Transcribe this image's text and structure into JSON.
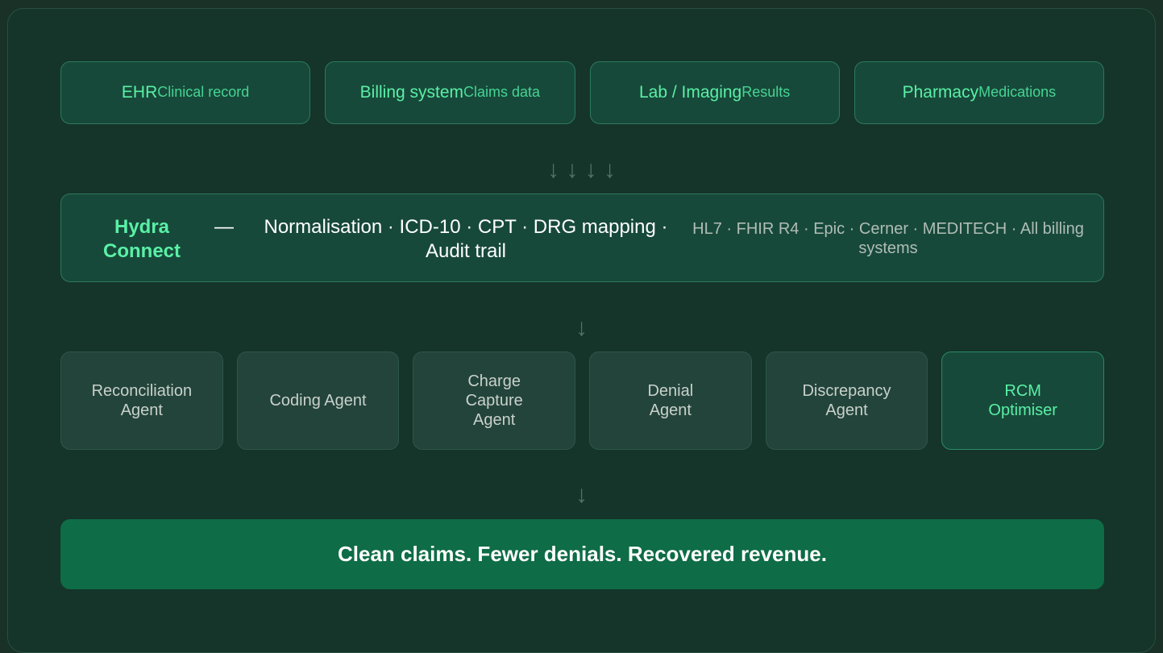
{
  "sources": [
    {
      "name": "EHR",
      "sub": "Clinical record"
    },
    {
      "name": "Billing system",
      "sub": "Claims data"
    },
    {
      "name": "Lab / Imaging",
      "sub": "Results"
    },
    {
      "name": "Pharmacy",
      "sub": "Medications"
    }
  ],
  "arrows": {
    "top": "↓ ↓ ↓ ↓",
    "middle": "↓",
    "bottom": "↓"
  },
  "hub": {
    "title": "Hydra Connect",
    "dash": "—",
    "features": "Normalisation · ICD-10 · CPT · DRG mapping · Audit trail",
    "integrations": "HL7 · FHIR R4 · Epic · Cerner · MEDITECH · All billing systems"
  },
  "agents": [
    {
      "label": "Reconciliation Agent"
    },
    {
      "label": "Coding Agent"
    },
    {
      "label": "Charge Capture Agent"
    },
    {
      "label": "Denial Agent"
    },
    {
      "label": "Discrepancy Agent"
    },
    {
      "label": "RCM Optimiser",
      "highlight": true
    }
  ],
  "outcome": {
    "text": "Clean claims. Fewer denials. Recovered revenue."
  },
  "colors": {
    "background": "#15342a",
    "accent": "#5af0a6",
    "outcome_bar": "#0e6c46"
  }
}
